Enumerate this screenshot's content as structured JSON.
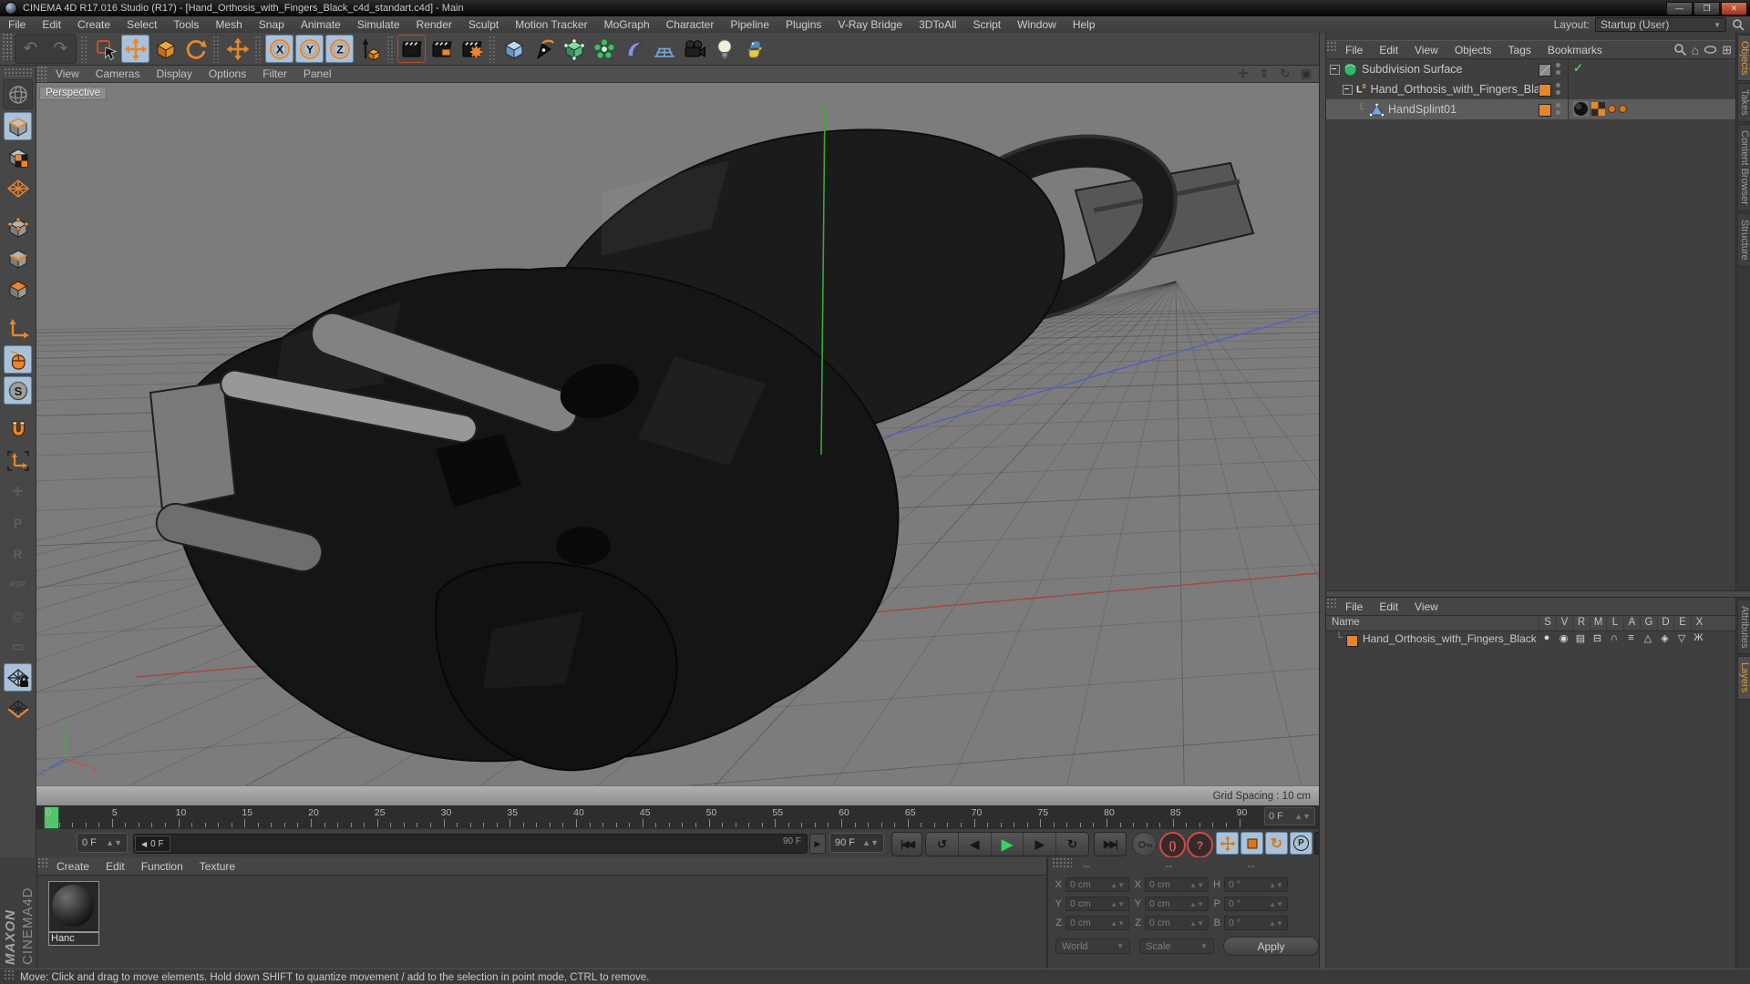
{
  "window": {
    "title": "CINEMA 4D R17.016 Studio (R17) - [Hand_Orthosis_with_Fingers_Black_c4d_standart.c4d] - Main",
    "controls": [
      {
        "name": "minimize-button",
        "glyph": "—"
      },
      {
        "name": "maximize-button",
        "glyph": "❐"
      },
      {
        "name": "close-button",
        "glyph": "✕"
      }
    ]
  },
  "menu_bar": {
    "items": [
      "File",
      "Edit",
      "Create",
      "Select",
      "Tools",
      "Mesh",
      "Snap",
      "Animate",
      "Simulate",
      "Render",
      "Sculpt",
      "Motion Tracker",
      "MoGraph",
      "Character",
      "Pipeline",
      "Plugins",
      "V-Ray Bridge",
      "3DToAll",
      "Script",
      "Window",
      "Help"
    ],
    "layout_label": "Layout:",
    "layout_value": "Startup (User)"
  },
  "main_toolbar": {
    "items": [
      {
        "name": "undo-button",
        "icon": "undo",
        "group": "recessed"
      },
      {
        "name": "redo-button",
        "icon": "redo",
        "group": "recessed"
      },
      {
        "sep": true
      },
      {
        "name": "live-selection-tool",
        "icon": "live-selection"
      },
      {
        "name": "move-tool",
        "icon": "move",
        "active": true
      },
      {
        "name": "scale-tool",
        "icon": "scale"
      },
      {
        "name": "rotate-tool",
        "icon": "rotate"
      },
      {
        "sep": true
      },
      {
        "name": "last-used-tool",
        "icon": "move"
      },
      {
        "sep": true
      },
      {
        "name": "lock-x-axis-button",
        "icon": "axis-lock",
        "glyph": "X",
        "active": true
      },
      {
        "name": "lock-y-axis-button",
        "icon": "axis-lock",
        "glyph": "Y",
        "active": true
      },
      {
        "name": "lock-z-axis-button",
        "icon": "axis-lock",
        "glyph": "Z",
        "active": true
      },
      {
        "name": "coordinate-system-button",
        "icon": "coord-sys"
      },
      {
        "sep": true
      },
      {
        "name": "render-view-button",
        "icon": "clapper",
        "outlined": true
      },
      {
        "name": "render-picture-viewer-button",
        "icon": "clapper-pv"
      },
      {
        "name": "render-settings-button",
        "icon": "clapper-gear"
      },
      {
        "sep": true
      },
      {
        "name": "add-cube-primitive-button",
        "icon": "prim-cube"
      },
      {
        "name": "spline-pen-button",
        "icon": "pen"
      },
      {
        "name": "subdivision-surface-button",
        "icon": "sds-cube"
      },
      {
        "name": "generators-button",
        "icon": "generators"
      },
      {
        "name": "deformers-button",
        "icon": "deformer"
      },
      {
        "name": "environment-objects-button",
        "icon": "environment"
      },
      {
        "name": "camera-objects-button",
        "icon": "camera"
      },
      {
        "name": "light-objects-button",
        "icon": "light"
      },
      {
        "name": "python-scripting-button",
        "icon": "python"
      }
    ]
  },
  "left_toolbar": {
    "items": [
      {
        "name": "make-editable-button",
        "icon": "globe",
        "state": "recessed"
      },
      {
        "name": "model-mode-button",
        "icon": "mode-model",
        "state": "active"
      },
      {
        "name": "texture-mode-button",
        "icon": "mode-texture"
      },
      {
        "name": "workplane-mode-button",
        "icon": "mode-workplane"
      },
      {
        "gap": true
      },
      {
        "name": "points-mode-button",
        "icon": "mode-points"
      },
      {
        "name": "edges-mode-button",
        "icon": "mode-edges"
      },
      {
        "name": "polygons-mode-button",
        "icon": "mode-polys"
      },
      {
        "gap": true
      },
      {
        "name": "enable-axis-button",
        "icon": "mode-axis"
      },
      {
        "name": "snap-toggle-button",
        "icon": "snap-mouse",
        "state": "active"
      },
      {
        "name": "snap-settings-button",
        "icon": "snap-s",
        "state": "active"
      },
      {
        "gap": true
      },
      {
        "name": "quantize-magnet-button",
        "icon": "magnet"
      },
      {
        "name": "workplane-axis-button",
        "icon": "workplane-axis"
      },
      {
        "name": "coord-copy-button",
        "icon": "ghost",
        "glyph": "✛",
        "state": "ghost"
      },
      {
        "name": "copy-position-button",
        "icon": "ghost",
        "glyph": "P",
        "state": "ghost"
      },
      {
        "name": "copy-rotation-button",
        "icon": "ghost",
        "glyph": "R",
        "state": "ghost"
      },
      {
        "name": "copy-psr-button",
        "icon": "ghost",
        "glyph": "PSR",
        "state": "ghost"
      },
      {
        "name": "key-at-button",
        "icon": "ghost",
        "glyph": "@",
        "state": "ghost"
      },
      {
        "name": "key-rect-button",
        "icon": "ghost",
        "glyph": "▭",
        "state": "ghost"
      },
      {
        "name": "lock-workplane-button",
        "icon": "lock-workplane",
        "state": "active"
      },
      {
        "name": "planar-workplane-button",
        "icon": "workplane-orange"
      }
    ]
  },
  "viewport": {
    "menu": [
      "View",
      "Cameras",
      "Display",
      "Options",
      "Filter",
      "Panel"
    ],
    "nav_icons": [
      {
        "name": "pan-view-icon",
        "glyph": "✛"
      },
      {
        "name": "zoom-view-icon",
        "glyph": "⇕"
      },
      {
        "name": "rotate-view-icon",
        "glyph": "↻"
      },
      {
        "name": "toggle-view-icon",
        "glyph": "▣"
      }
    ],
    "camera_label": "Perspective",
    "grid_spacing": "Grid Spacing : 10 cm",
    "axis_labels": {
      "x": "X",
      "y": "Y",
      "z": "Z"
    }
  },
  "object_manager": {
    "menu": [
      "File",
      "Edit",
      "View",
      "Objects",
      "Tags",
      "Bookmarks"
    ],
    "corner_icons": [
      "search-icon",
      "home-icon",
      "filter-oval-icon",
      "add-panel-icon"
    ],
    "tabs": [
      "Objects",
      "Takes",
      "Content Browser",
      "Structure"
    ],
    "active_tab": "Objects",
    "rows": [
      {
        "label": "Subdivision Surface",
        "icon": "sds-sphere",
        "level": 0,
        "expander": true,
        "chip": "slash",
        "check": "✓"
      },
      {
        "label": "Hand_Orthosis_with_Fingers_Black",
        "icon": "null-lo",
        "level": 1,
        "expander": true,
        "chip": "#e8862e"
      },
      {
        "label": "HandSplint01",
        "icon": "poly-tri",
        "level": 2,
        "branch": true,
        "chip": "#e8862e",
        "selected": true,
        "tags": [
          "material-tag",
          "uvw-tag",
          "phong-dot",
          "phong-dot"
        ]
      }
    ]
  },
  "layer_manager": {
    "menu": [
      "File",
      "Edit",
      "View"
    ],
    "name_header": "Name",
    "columns": [
      "S",
      "V",
      "R",
      "M",
      "L",
      "A",
      "G",
      "D",
      "E",
      "X"
    ],
    "tabs": [
      "Attributes",
      "Layers"
    ],
    "active_tab": "Layers",
    "rows": [
      {
        "name": "Hand_Orthosis_with_Fingers_Black",
        "chip": "#e8862e",
        "cells": [
          "●",
          "◉",
          "▤",
          "⊟",
          "∩",
          "≡",
          "△",
          "◈",
          "▽",
          "Ж"
        ]
      }
    ]
  },
  "timeline": {
    "frame_labels": [
      "0",
      "5",
      "10",
      "15",
      "20",
      "25",
      "30",
      "35",
      "40",
      "45",
      "50",
      "55",
      "60",
      "65",
      "70",
      "75",
      "80",
      "85",
      "90"
    ],
    "frame_box": "0 F"
  },
  "transport": {
    "current_frame": "0 F",
    "slider_handle": "0 F",
    "slider_end_label": "90 F",
    "end_frame": "90 F",
    "buttons": [
      {
        "name": "goto-start-button",
        "glyph": "|◀◀"
      },
      {
        "name": "cycle-backward-button",
        "glyph": "↺"
      },
      {
        "name": "previous-frame-button",
        "glyph": "◀"
      },
      {
        "name": "play-button",
        "glyph": "▶",
        "play": true
      },
      {
        "name": "next-frame-button",
        "glyph": "▶"
      },
      {
        "name": "cycle-forward-button",
        "glyph": "↻"
      },
      {
        "name": "goto-end-button",
        "glyph": "▶▶|"
      }
    ],
    "record_buttons": [
      {
        "name": "record-keyframe-button",
        "kind": "key"
      },
      {
        "name": "record-active-objects-button",
        "glyph": "()",
        "kind": "rec"
      },
      {
        "name": "autokeying-button",
        "glyph": "?",
        "kind": "rec"
      }
    ],
    "key_toggles": [
      {
        "name": "record-position-toggle",
        "icon": "move-small",
        "active": true
      },
      {
        "name": "record-scale-toggle",
        "icon": "scale-small",
        "active": true
      },
      {
        "name": "record-rotation-toggle",
        "glyph": "↻",
        "active": true
      },
      {
        "name": "record-parameter-toggle",
        "glyph": "P",
        "circle": true,
        "active": true
      },
      {
        "name": "record-pla-toggle",
        "icon": "pla-dots",
        "dark": true
      },
      {
        "gap": true
      },
      {
        "name": "timeline-film-button",
        "icon": "film",
        "active": true
      }
    ]
  },
  "material_manager": {
    "menu": [
      "Create",
      "Edit",
      "Function",
      "Texture"
    ],
    "materials": [
      {
        "name": "Hanc"
      }
    ]
  },
  "coordinates": {
    "group_headers": [
      "--",
      "--",
      "--"
    ],
    "rows": [
      {
        "c1": "X",
        "v1": "0 cm",
        "c2": "X",
        "v2": "0 cm",
        "c3": "H",
        "v3": "0 °"
      },
      {
        "c1": "Y",
        "v1": "0 cm",
        "c2": "Y",
        "v2": "0 cm",
        "c3": "P",
        "v3": "0 °"
      },
      {
        "c1": "Z",
        "v1": "0 cm",
        "c2": "Z",
        "v2": "0 cm",
        "c3": "B",
        "v3": "0 °"
      }
    ],
    "select1": "World",
    "select2": "Scale",
    "apply_label": "Apply"
  },
  "status_bar": {
    "text": "Move: Click and drag to move elements. Hold down SHIFT to quantize movement / add to the selection in point mode, CTRL to remove."
  },
  "brand": {
    "maxon": "MAXON",
    "cinema": "CINEMA4D"
  },
  "colors": {
    "accent_orange": "#e8862e",
    "active_blue": "#a9c2da",
    "play_green": "#35d35f",
    "record_red": "#cf4a4a"
  }
}
